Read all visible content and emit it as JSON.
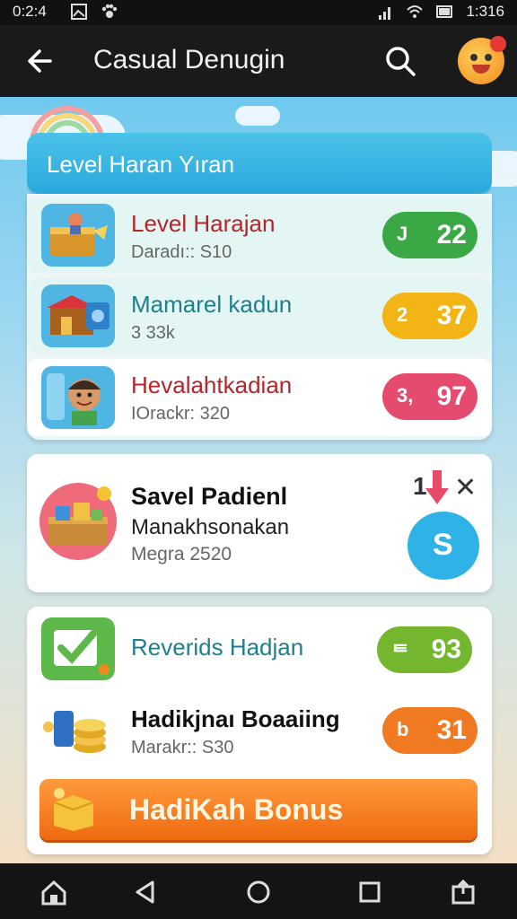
{
  "status_bar": {
    "time_left": "0:2:4",
    "time_right": "1:316"
  },
  "app_bar": {
    "title": "Casual Denugin"
  },
  "header": {
    "title": "Level Haran Yıran"
  },
  "rows": [
    {
      "title": "Level Harajan",
      "subtitle": "Daradı:: S10",
      "badge_left": "J",
      "badge_value": "22",
      "color": "#3aa845",
      "title_color": "#b3262c"
    },
    {
      "title": "Mamarel kadun",
      "subtitle": "3 33k",
      "badge_left": "2",
      "badge_value": "37",
      "color": "#f2b515",
      "title_color": "#1f7f8c"
    },
    {
      "title": "Hevalahtkadian",
      "subtitle": "IOrackr: 320",
      "badge_left": "3,",
      "badge_value": "97",
      "color": "#e54b6f",
      "title_color": "#b3262c"
    }
  ],
  "feature_card": {
    "title": "Savel Padienl",
    "subtitle": "Manakhsonakan",
    "meta": "Megra 2520",
    "counter": "1",
    "close": "✕",
    "bubble_label": "S"
  },
  "lower_rows": [
    {
      "title": "Reverids Hadjan",
      "subtitle": "",
      "badge_left": "ᄐ",
      "badge_value": "93",
      "color": "#74b72e",
      "title_color": "#1f7f8c"
    },
    {
      "title": "Hadikjnaı Boaaiing",
      "subtitle": "Marakr:: S30",
      "badge_left": "b",
      "badge_value": "31",
      "color": "#f07a22",
      "title_color": "#111111"
    }
  ],
  "bonus_button": {
    "label": "HadiKah Bonus"
  },
  "icons": {
    "back": "arrow-left-icon",
    "search": "search-icon",
    "avatar": "avatar-icon",
    "nav": [
      "home-icon",
      "back-triangle-icon",
      "home-circle-icon",
      "recents-square-icon",
      "share-icon"
    ]
  }
}
